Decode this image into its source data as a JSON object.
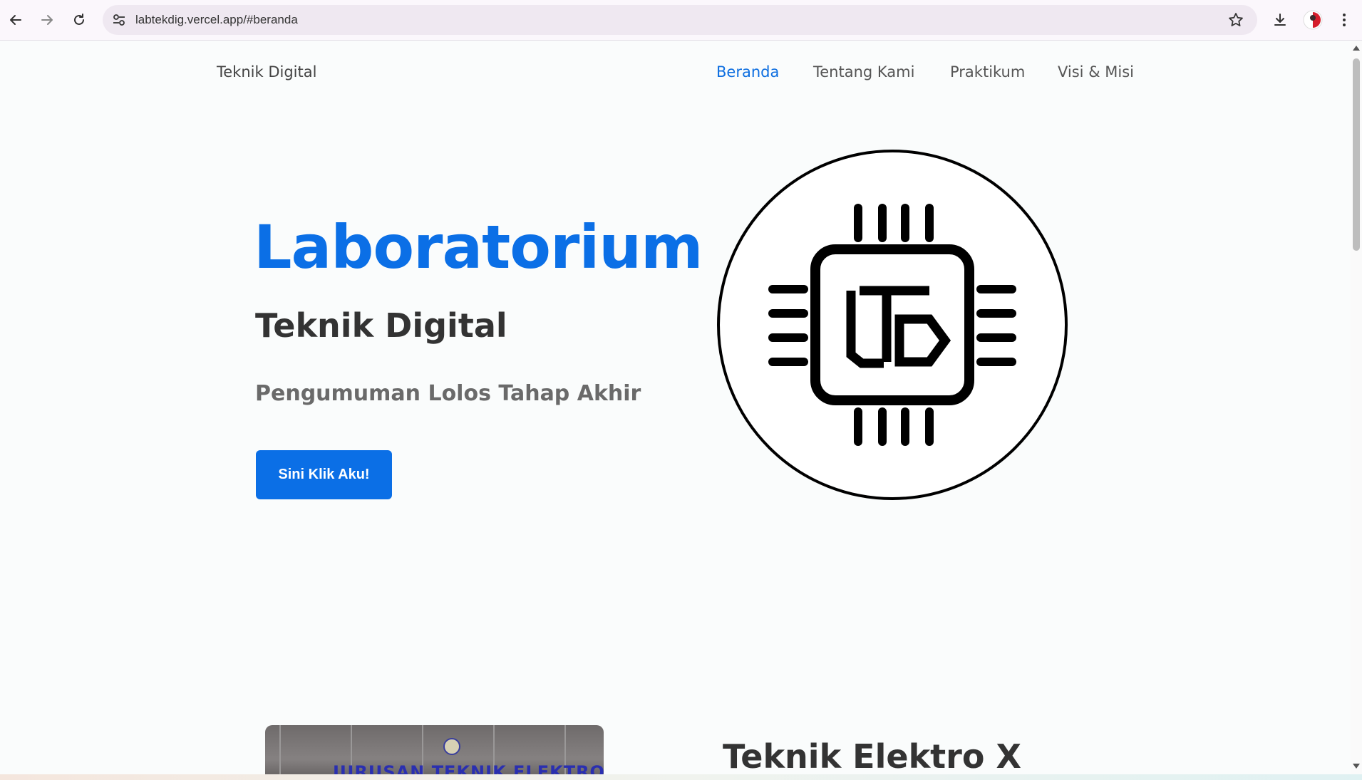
{
  "browser": {
    "url": "labtekdig.vercel.app/#beranda"
  },
  "nav": {
    "brand": "Teknik Digital",
    "items": [
      {
        "label": "Beranda"
      },
      {
        "label": "Tentang Kami"
      },
      {
        "label": "Praktikum"
      },
      {
        "label": "Visi & Misi"
      }
    ]
  },
  "hero": {
    "title": "Laboratorium",
    "subtitle": "Teknik Digital",
    "announcement": "Pengumuman Lolos Tahap Akhir",
    "cta_label": "Sini Klik Aku!"
  },
  "about": {
    "photo_text": "JURUSAN TEKNIK ELEKTRO",
    "title": "Teknik Elektro X"
  },
  "colors": {
    "accent": "#0b6fe6",
    "text_dark": "#333333",
    "text_muted": "#6a6a6a"
  },
  "icons": [
    "back-icon",
    "forward-icon",
    "reload-icon",
    "site-settings-icon",
    "bookmark-star-icon",
    "download-icon",
    "profile-avatar",
    "more-menu-icon"
  ]
}
